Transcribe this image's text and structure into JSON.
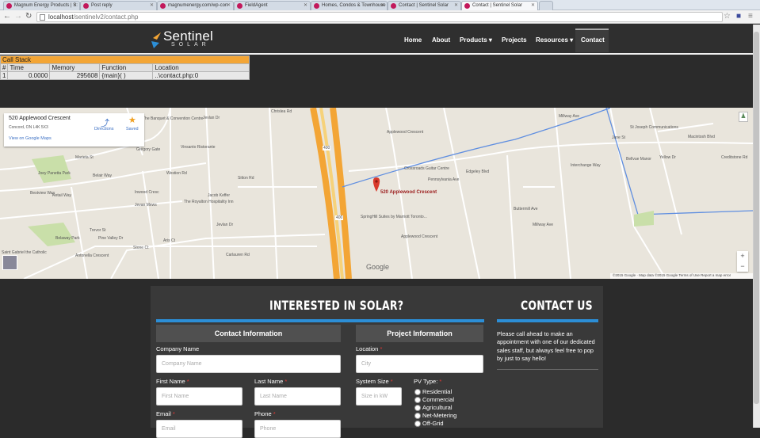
{
  "browser": {
    "tabs": [
      {
        "title": "Magnum Energy Products | S:"
      },
      {
        "title": "Post reply"
      },
      {
        "title": "magnumenergy.com/wp-con"
      },
      {
        "title": "FieldAgent"
      },
      {
        "title": "Homes, Condos & Townhouse"
      },
      {
        "title": "Contact | Sentinel Solar"
      },
      {
        "title": "Contact | Sentinel Solar"
      }
    ],
    "url_host": "localhost",
    "url_path": "/sentinelv2/contact.php"
  },
  "site": {
    "logo_line1": "Sentinel",
    "logo_line2": "SOLAR",
    "nav": [
      {
        "label": "Home"
      },
      {
        "label": "About"
      },
      {
        "label": "Products ▾"
      },
      {
        "label": "Projects"
      },
      {
        "label": "Resources ▾"
      },
      {
        "label": "Contact"
      }
    ]
  },
  "call_stack": {
    "title": "Call Stack",
    "columns": [
      "#",
      "Time",
      "Memory",
      "Function",
      "Location"
    ],
    "rows": [
      [
        "1",
        "0.0000",
        "295608",
        "{main}( )",
        "..\\contact.php:0"
      ]
    ]
  },
  "map": {
    "info_address": "520 Applewood Crescent",
    "info_city": "Concord, ON L4K 5X3",
    "info_link": "View on Google Maps",
    "directions": "Directions",
    "saved": "Saved",
    "marker_label": "520 Applewood Crescent",
    "google": "Google",
    "terms": "©2015 Google · Map data ©2015 Google     Terms of Use     Report a map error",
    "zoom_in": "+",
    "zoom_out": "−",
    "labels": {
      "l1": "The Banquet & Convention Centre",
      "l2": "Gregory Gate",
      "l3": "Marieta St",
      "l4": "Joey Panetta Park",
      "l5": "Belair Way",
      "l6": "Vinsanto Ristorante",
      "l7": "Jevlan Dr",
      "l8": "Sitton Rd",
      "l9": "Chrislea Rd",
      "l10": "Westion Rd",
      "l11": "The Royalton Hospitality Inn",
      "l12": "Jacob Keffer",
      "l13": "Jevlan Dr",
      "l14": "Applewood Crescent",
      "l15": "Crossroads Guitar Centre",
      "l16": "Pennsylvania Ave",
      "l17": "SpringHill Suites by Marriott Toronto...",
      "l18": "Applewood Crescent",
      "l19": "Edgeley Blvd",
      "l20": "Millway Ave",
      "l21": "Buttermill Ave",
      "l22": "Interchange Way",
      "l23": "Millway Ave",
      "l24": "Jane St",
      "l25": "St Joseph Communications",
      "l26": "Macintosh Blvd",
      "l27": "Bellvue Manor",
      "l28": "Yellow Dr",
      "l29": "Creditstone Rd",
      "l30": "Belaway Park",
      "l31": "Trevor St",
      "l32": "Antonella Crescent",
      "l33": "Carlauren Rd",
      "l34": "Saint Gabriel the Catholic",
      "l35": "Retail Way",
      "l36": "Inwood Cresc",
      "l37": "Bestview Way",
      "l38": "Jevan Mews",
      "l39": "Aris Ct",
      "l40": "Stone Ct",
      "l41": "400",
      "l42": "400",
      "l43": "Pine Valley Dr"
    }
  },
  "solar_form": {
    "heading": "INTERESTED IN SOLAR?",
    "contact_info_title": "Contact Information",
    "project_info_title": "Project Information",
    "company_label": "Company Name",
    "company_placeholder": "Company Name",
    "first_label": "First Name",
    "first_placeholder": "First Name",
    "last_label": "Last Name",
    "last_placeholder": "Last Name",
    "email_label": "Email",
    "email_placeholder": "Email",
    "phone_label": "Phone",
    "phone_placeholder": "Phone",
    "location_label": "Location",
    "location_placeholder": "City",
    "size_label": "System Size",
    "size_placeholder": "Size in kW",
    "pv_label": "PV Type:",
    "required_mark": "*",
    "pv_options": [
      "Residential",
      "Commercial",
      "Agricultural",
      "Net-Metering",
      "Off-Grid"
    ]
  },
  "contact": {
    "heading": "CONTACT US",
    "text": "Please call ahead to make an appointment with one of our dedicated sales staff, but always feel free to pop by just to say hello!"
  },
  "colors": {
    "accent_blue": "#2c8ed6",
    "highway_orange": "#f3a535",
    "required_red": "#e53935"
  }
}
